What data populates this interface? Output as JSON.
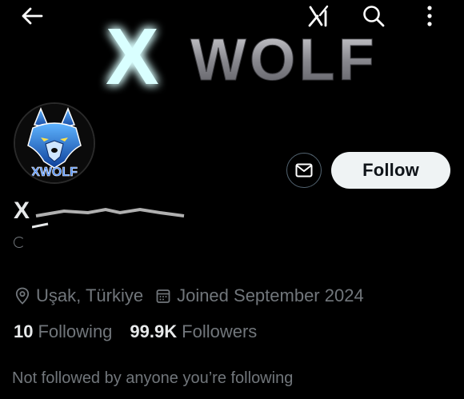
{
  "banner": {
    "logo_left": "X",
    "logo_right": "WOLF"
  },
  "topbar": {
    "back_icon": "arrow-left-icon",
    "grok_icon": "grok-icon",
    "search_icon": "search-icon",
    "more_icon": "more-vertical-icon"
  },
  "avatar": {
    "text": "XWOLF"
  },
  "actions": {
    "message_icon": "envelope-icon",
    "follow_label": "Follow"
  },
  "profile": {
    "display_name": "X WOLF"
  },
  "meta": {
    "location": "Uşak, Türkiye",
    "joined": "Joined September 2024",
    "location_icon": "location-pin-icon",
    "calendar_icon": "calendar-icon"
  },
  "counts": {
    "following_value": "10",
    "following_label": "Following",
    "followers_value": "99.9K",
    "followers_label": "Followers"
  },
  "not_followed_text": "Not followed by anyone you’re following",
  "colors": {
    "background": "#000000",
    "text_primary": "#e7e9ea",
    "text_secondary": "#71767b",
    "follow_bg": "#eff3f4",
    "logo_glow": "#6ff3ff"
  }
}
